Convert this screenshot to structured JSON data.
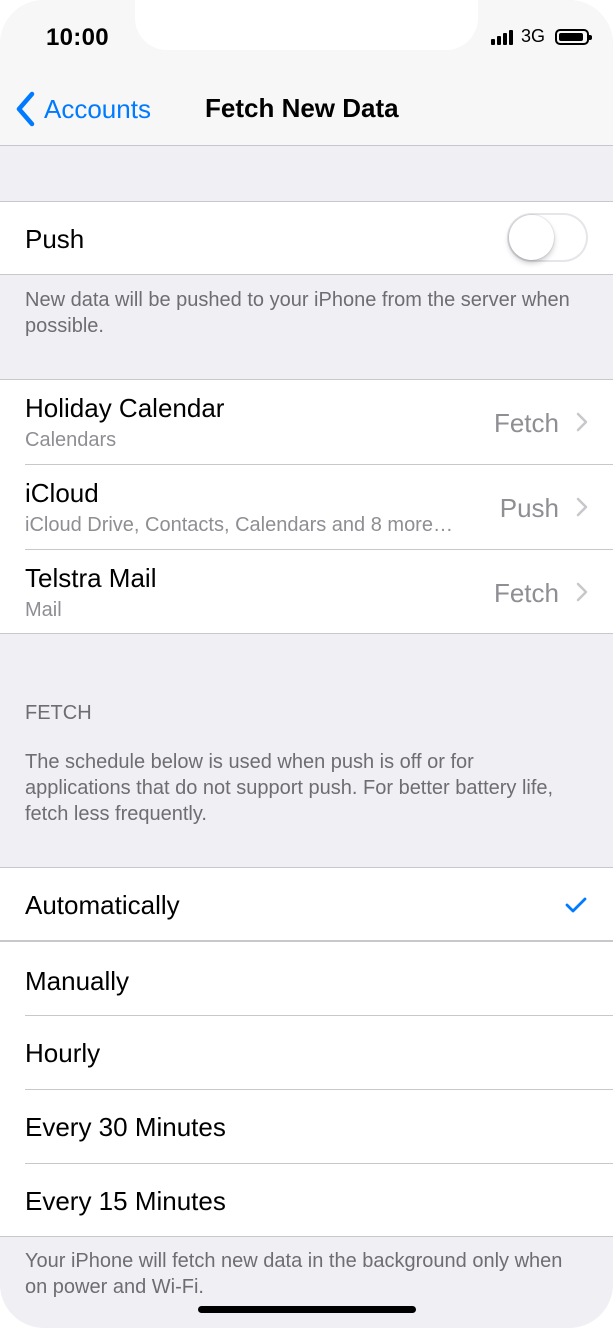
{
  "status_bar": {
    "time": "10:00",
    "network": "3G"
  },
  "nav": {
    "back_label": "Accounts",
    "title": "Fetch New Data"
  },
  "push": {
    "label": "Push",
    "enabled": false,
    "description": "New data will be pushed to your iPhone from the server when possible."
  },
  "accounts": [
    {
      "name": "Holiday Calendar",
      "services": "Calendars",
      "mode": "Fetch"
    },
    {
      "name": "iCloud",
      "services": "iCloud Drive, Contacts, Calendars and 8 more…",
      "mode": "Push"
    },
    {
      "name": "Telstra Mail",
      "services": "Mail",
      "mode": "Fetch"
    }
  ],
  "fetch": {
    "header": "FETCH",
    "description": "The schedule below is used when push is off or for applications that do not support push. For better battery life, fetch less frequently.",
    "options": [
      {
        "label": "Automatically",
        "selected": true
      },
      {
        "label": "Manually",
        "selected": false
      },
      {
        "label": "Hourly",
        "selected": false
      },
      {
        "label": "Every 30 Minutes",
        "selected": false
      },
      {
        "label": "Every 15 Minutes",
        "selected": false
      }
    ],
    "footer": "Your iPhone will fetch new data in the background only when on power and Wi-Fi."
  },
  "colors": {
    "accent": "#007aff",
    "background": "#efeff4",
    "separator": "#c8c7cc",
    "secondary_text": "#8e8e93"
  }
}
